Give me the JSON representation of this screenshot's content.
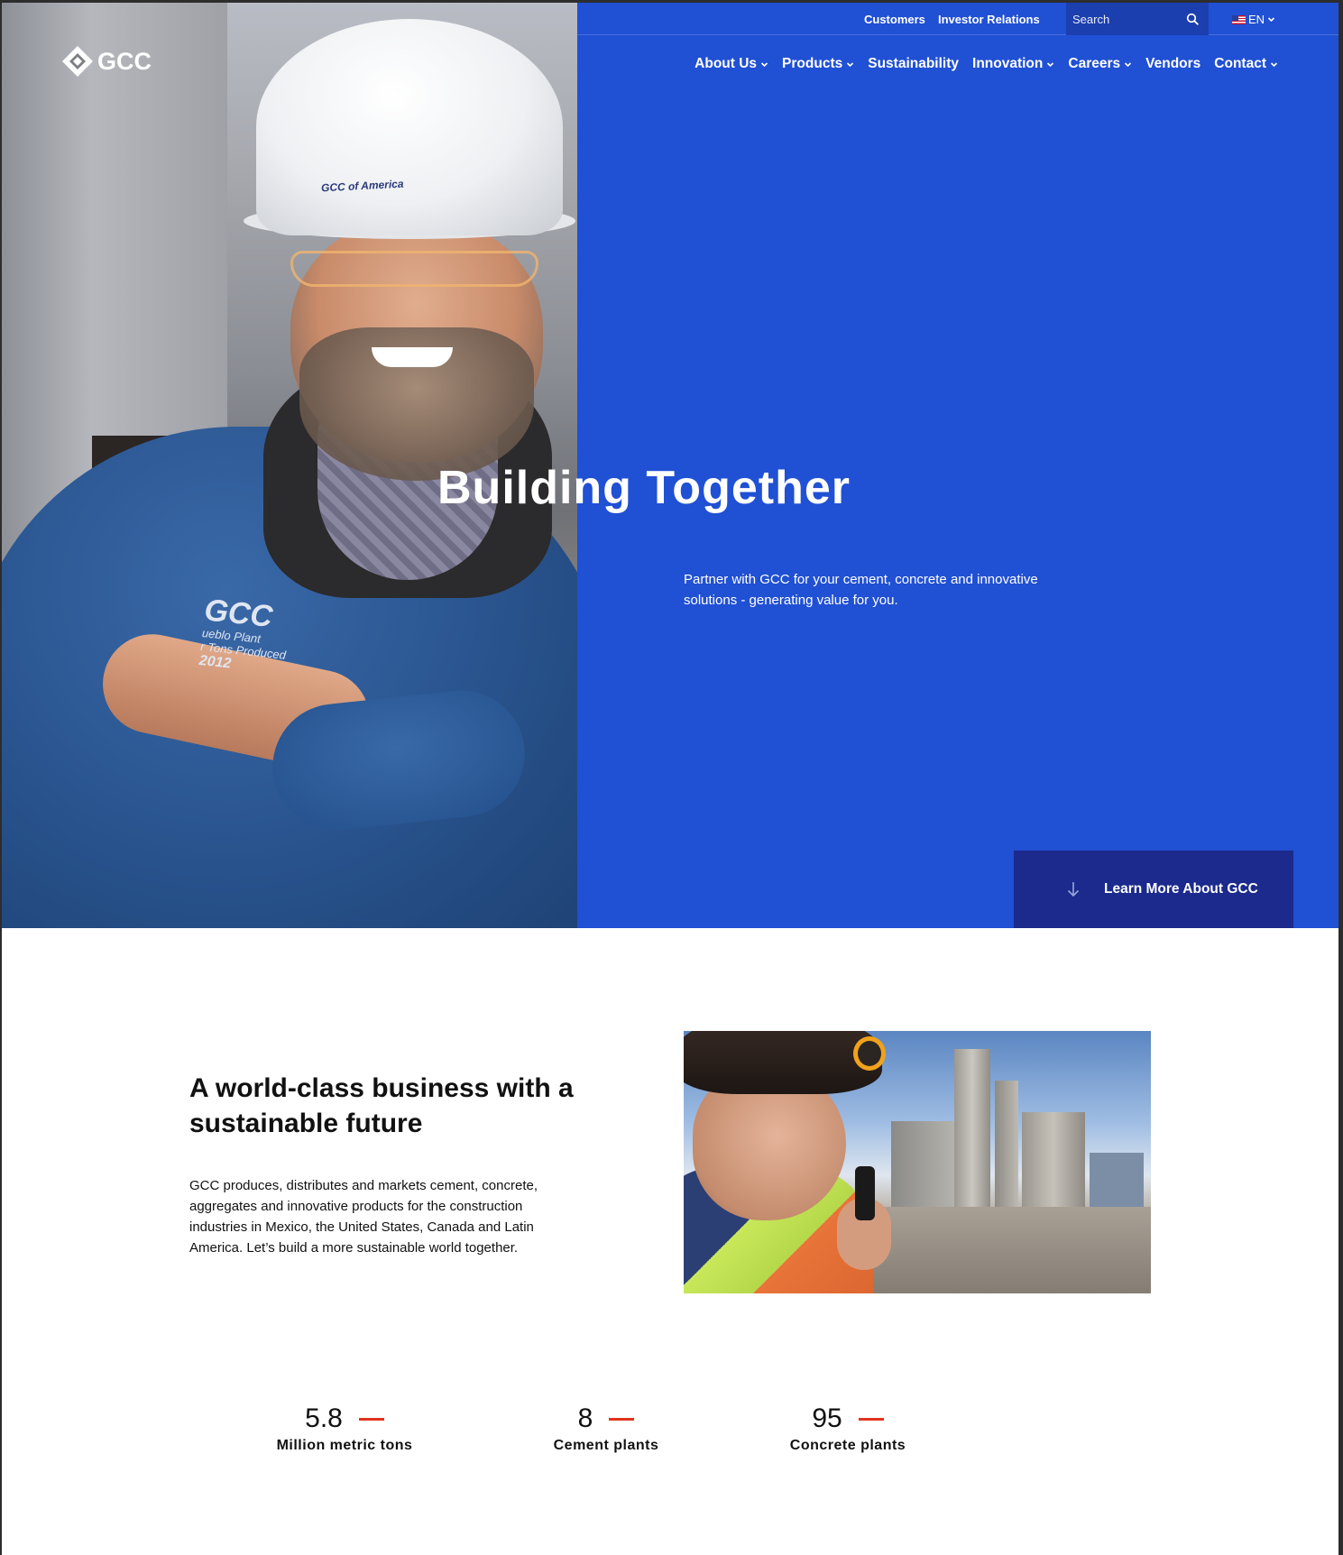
{
  "colors": {
    "hero_blue": "#2050d3",
    "button_navy": "#1b2a8c",
    "search_bg": "#1b3fae",
    "accent_red": "#e0341e",
    "text_dark": "#111111"
  },
  "utility": {
    "customers": "Customers",
    "investor_relations": "Investor Relations",
    "search_placeholder": "Search",
    "search_icon": "search-icon",
    "language": "EN"
  },
  "logo": {
    "text": "GCC"
  },
  "nav": {
    "items": [
      {
        "label": "About Us",
        "dropdown": true
      },
      {
        "label": "Products",
        "dropdown": true
      },
      {
        "label": "Sustainability",
        "dropdown": false
      },
      {
        "label": "Innovation",
        "dropdown": true
      },
      {
        "label": "Careers",
        "dropdown": true
      },
      {
        "label": "Vendors",
        "dropdown": false
      },
      {
        "label": "Contact",
        "dropdown": true
      }
    ]
  },
  "hero": {
    "title": "Building Together",
    "subtitle": "Partner with GCC for your cement, concrete and innovative solutions - generating value for you.",
    "cta": "Learn More About GCC",
    "photo_text": {
      "helmet": "GCC of America",
      "badge_line1": "GCC",
      "badge_line2": "ueblo Plant",
      "badge_line3": "r Tons Produced",
      "badge_line4": "2012"
    }
  },
  "about": {
    "title": "A world-class business with a sustainable future",
    "text": "GCC produces, distributes and markets cement, concrete, aggregates and innovative products for the construction industries in Mexico, the United States, Canada and Latin America. Let’s build a more sustainable world together."
  },
  "stats": [
    {
      "value": "5.8",
      "label": "Million metric tons"
    },
    {
      "value": "8",
      "label": "Cement plants"
    },
    {
      "value": "95",
      "label": "Concrete plants"
    }
  ]
}
